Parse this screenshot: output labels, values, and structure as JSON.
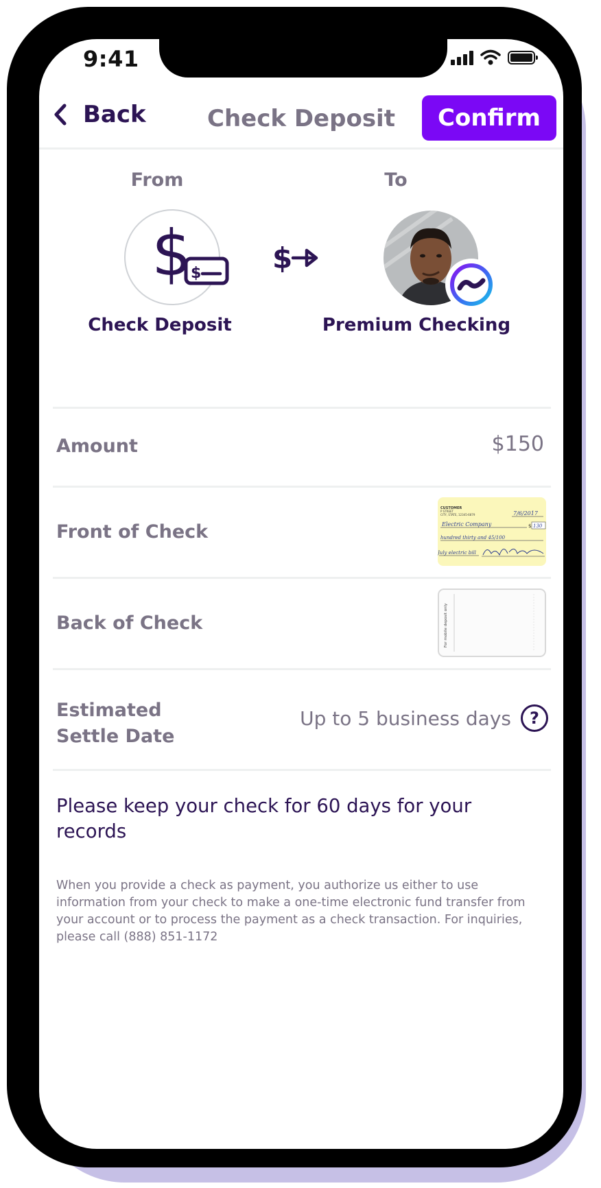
{
  "status_bar": {
    "time": "9:41"
  },
  "nav": {
    "back_label": "Back",
    "title": "Check Deposit",
    "confirm_label": "Confirm"
  },
  "transfer": {
    "from_label": "From",
    "to_label": "To",
    "from_name": "Check Deposit",
    "to_name": "Premium Checking",
    "from_icon": "dollar-check-icon",
    "arrow_icon": "money-transfer-arrow-icon",
    "to_badge_icon": "bank-brand-icon"
  },
  "details": {
    "amount_label": "Amount",
    "amount_value": "$150",
    "front_label": "Front of Check",
    "back_label": "Back of Check",
    "settle_label_line1": "Estimated",
    "settle_label_line2": "Settle Date",
    "settle_value": "Up to 5 business days",
    "help_icon": "question-circle-icon"
  },
  "check_front": {
    "payer_name": "CUSTOMER",
    "payer_street": "P STREET",
    "payer_city": "CITY, STATE, 12345-6879",
    "date": "7/6/2017",
    "payee": "Electric Company",
    "amount_box": "130",
    "written_amount": "hundred thirty and 45/100",
    "memo": "July electric bill"
  },
  "check_back": {
    "endorsement": "For mobile deposit only"
  },
  "notes": {
    "keep_check": "Please keep your check for 60 days for your records",
    "disclaimer": "When you provide a check as payment, you authorize us either to use information from your check to make a one-time electronic fund transfer from your account or to process the payment as a check transaction. For inquiries, please call (888) 851-1172"
  },
  "colors": {
    "brand_purple": "#7b08f5",
    "primary_text": "#2c1454",
    "secondary_text": "#7a7385",
    "divider": "#eef0f0",
    "phone_shadow": "#c6c0e6"
  }
}
